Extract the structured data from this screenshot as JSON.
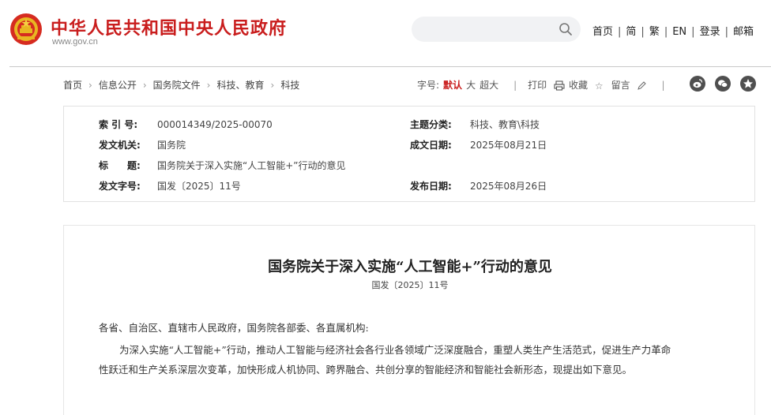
{
  "header": {
    "site_title": "中华人民共和国中央人民政府",
    "site_url": "www.gov.cn",
    "search_placeholder": "",
    "nav": [
      "首页",
      "简",
      "繁",
      "EN",
      "登录",
      "邮箱"
    ]
  },
  "breadcrumb": [
    "首页",
    "信息公开",
    "国务院文件",
    "科技、教育",
    "科技"
  ],
  "tools": {
    "font_label": "字号:",
    "font_sizes": [
      "默认",
      "大",
      "超大"
    ],
    "print": "打印",
    "favorite": "收藏",
    "comment": "留言"
  },
  "info": {
    "index_label": "索 引 号:",
    "index_value": "000014349/2025-00070",
    "topic_label": "主题分类:",
    "topic_value": "科技、教育\\科技",
    "issuer_label": "发文机关:",
    "issuer_value": "国务院",
    "date_written_label": "成文日期:",
    "date_written_value": "2025年08月21日",
    "title_label": "标　　题:",
    "title_value": "国务院关于深入实施“人工智能+”行动的意见",
    "doc_no_label": "发文字号:",
    "doc_no_value": "国发〔2025〕11号",
    "publish_label": "发布日期:",
    "publish_value": "2025年08月26日"
  },
  "article": {
    "title": "国务院关于深入实施“人工智能+”行动的意见",
    "doc_no": "国发〔2025〕11号",
    "salutation": "各省、自治区、直辖市人民政府，国务院各部委、各直属机构:",
    "para1_line1": "为深入实施“人工智能+”行动，推动人工智能与经济社会各行业各领域广泛深度融合，重塑人类生产生活范式，促进生产力革命",
    "para1_line2": "性跃迁和生产关系深层次变革，加快形成人机协同、跨界融合、共创分享的智能经济和智能社会新形态，现提出如下意见。"
  },
  "colors": {
    "brand_red": "#c91d1d",
    "share_icon_bg": "#4f4f4f"
  },
  "icons": [
    "national-emblem-icon",
    "search-icon",
    "print-icon",
    "star-icon",
    "pencil-icon",
    "weibo-icon",
    "wechat-icon",
    "qzone-icon"
  ]
}
